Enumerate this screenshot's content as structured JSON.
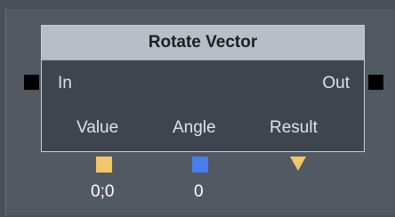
{
  "node": {
    "title": "Rotate Vector",
    "input_label": "In",
    "output_label": "Out",
    "columns": [
      {
        "label": "Value",
        "value": "0;0",
        "swatch_color": "#f3c66a",
        "swatch_shape": "square"
      },
      {
        "label": "Angle",
        "value": "0",
        "swatch_color": "#4b7cf0",
        "swatch_shape": "square"
      },
      {
        "label": "Result",
        "swatch_color": "#f3c66a",
        "swatch_shape": "triangle-down"
      }
    ]
  }
}
